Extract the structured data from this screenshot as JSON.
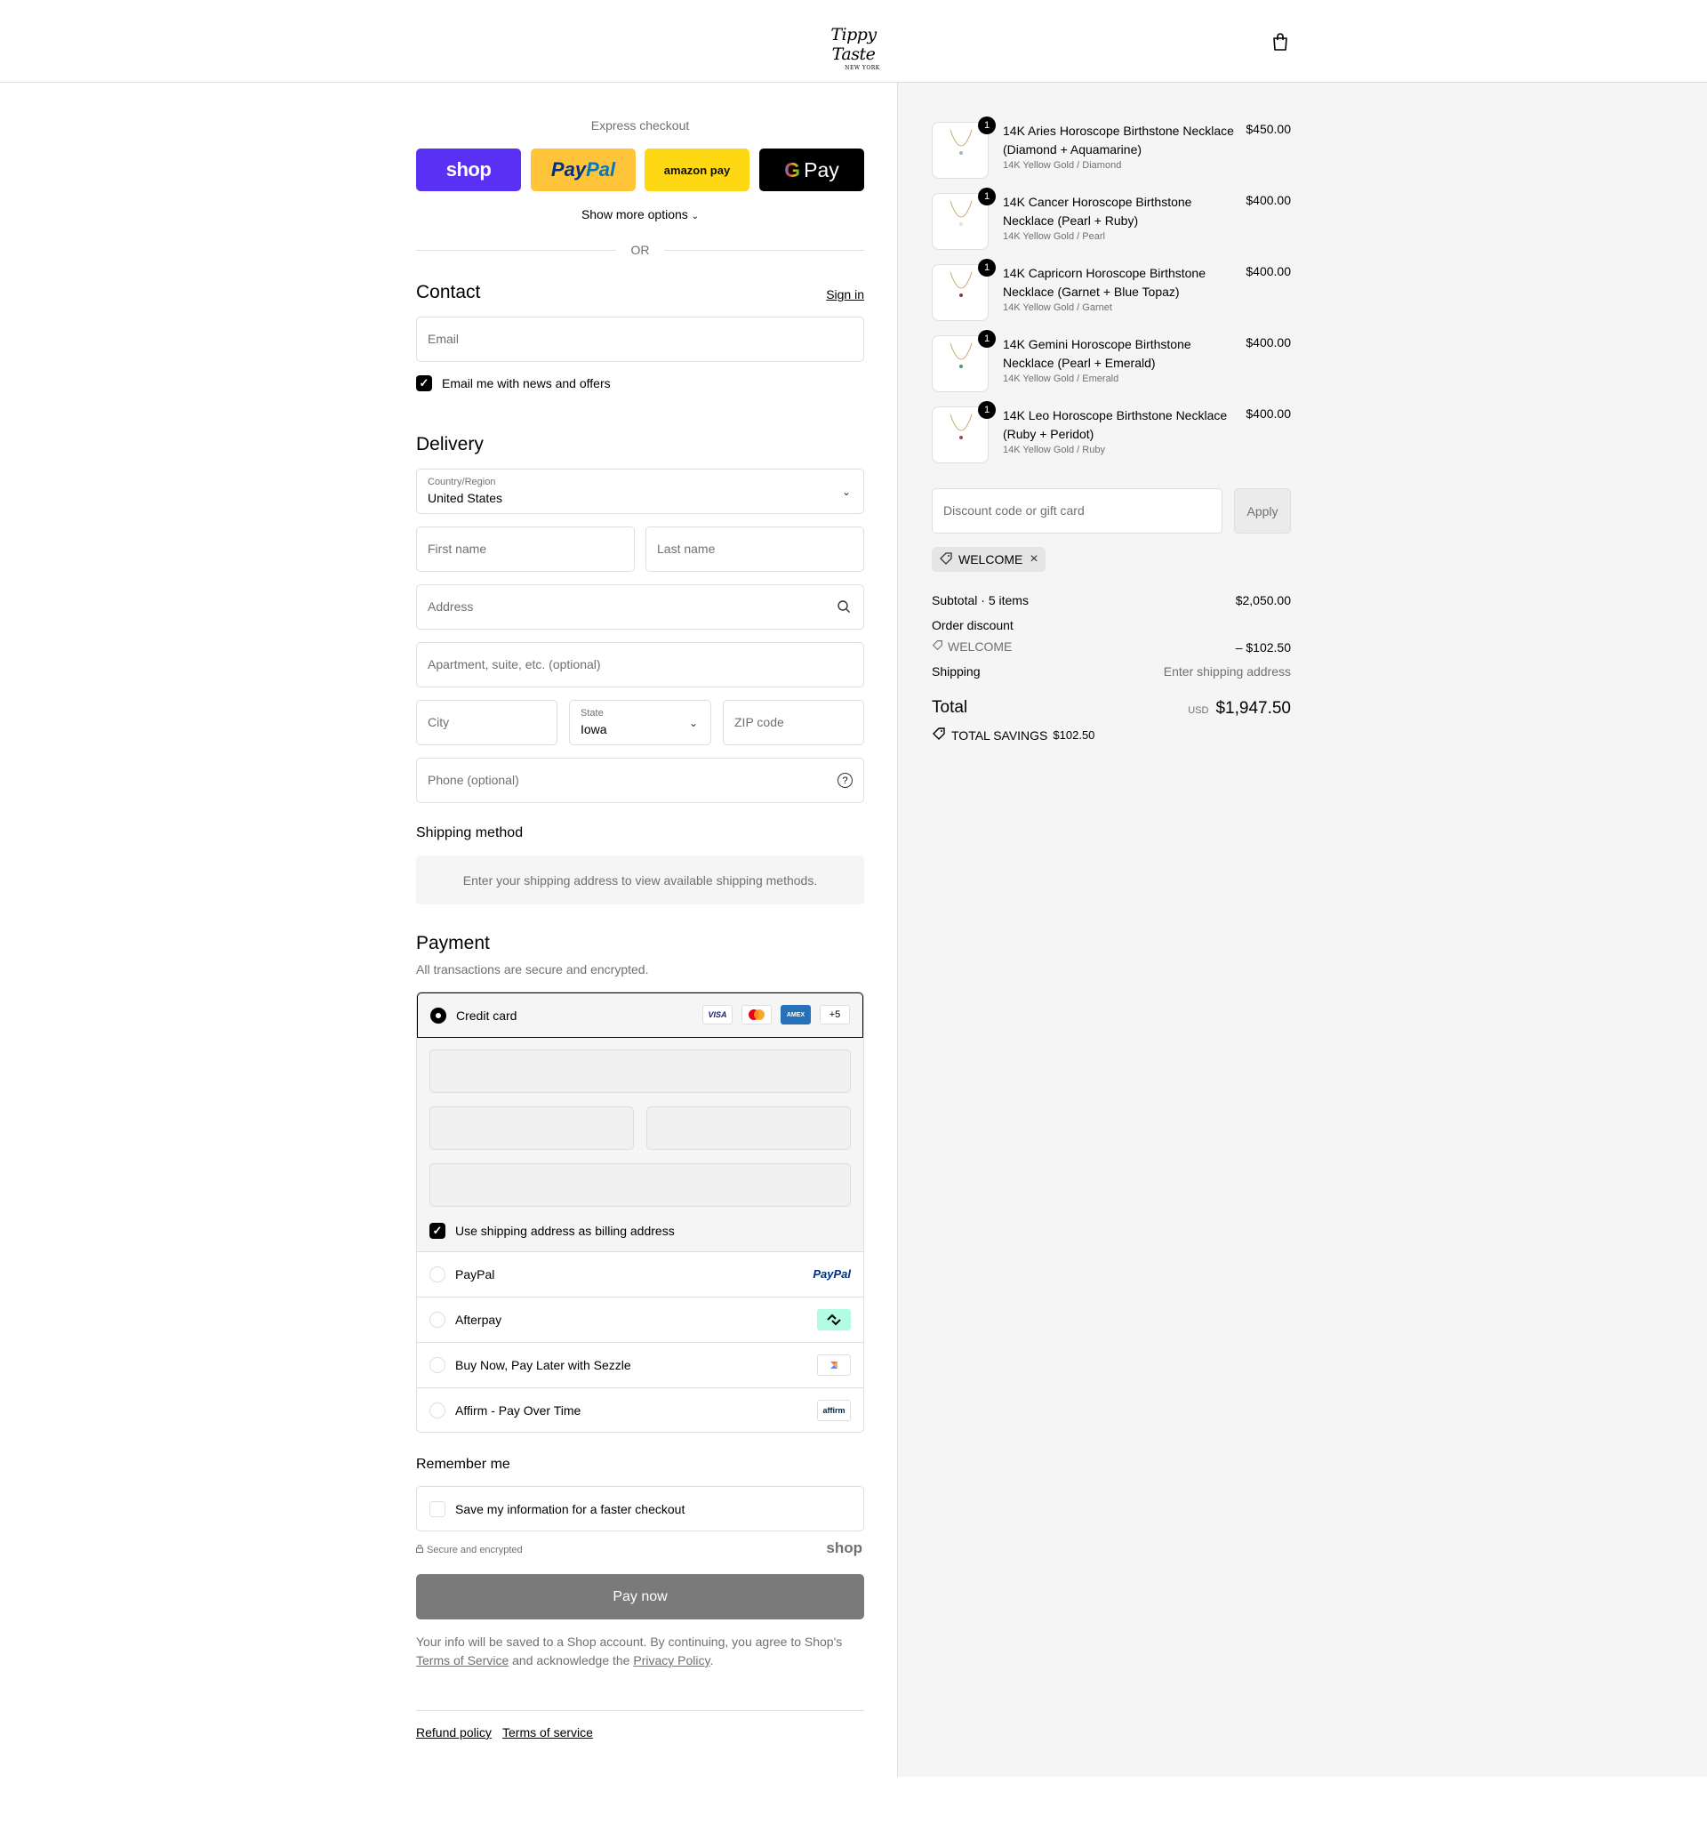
{
  "header": {
    "logo_main": "Tippy Taste",
    "logo_sub": "NEW YORK",
    "cart_icon": "shopping-bag-icon"
  },
  "express": {
    "title": "Express checkout",
    "shop_label": "shop",
    "paypal_pay": "Pay",
    "paypal_pal": "Pal",
    "amazon_label": "amazon pay",
    "gpay_g": "G",
    "gpay_label": "Pay",
    "show_more": "Show more options",
    "or": "OR"
  },
  "contact": {
    "heading": "Contact",
    "sign_in": "Sign in",
    "email_placeholder": "Email",
    "news_label": "Email me with news and offers",
    "news_checked": true
  },
  "delivery": {
    "heading": "Delivery",
    "country_label": "Country/Region",
    "country_value": "United States",
    "first_name": "First name",
    "last_name": "Last name",
    "address": "Address",
    "apartment": "Apartment, suite, etc. (optional)",
    "city": "City",
    "state_label": "State",
    "state_value": "Iowa",
    "zip": "ZIP code",
    "phone": "Phone (optional)"
  },
  "shipping_method": {
    "heading": "Shipping method",
    "message": "Enter your shipping address to view available shipping methods."
  },
  "payment": {
    "heading": "Payment",
    "subtitle": "All transactions are secure and encrypted.",
    "credit_card": "Credit card",
    "card_more": "+5",
    "billing_label": "Use shipping address as billing address",
    "options": [
      {
        "label": "PayPal",
        "logo": "PayPal"
      },
      {
        "label": "Afterpay",
        "logo": "afterpay-icon"
      },
      {
        "label": "Buy Now, Pay Later with Sezzle",
        "logo": "sezzle-icon"
      },
      {
        "label": "Affirm - Pay Over Time",
        "logo": "affirm"
      }
    ]
  },
  "remember": {
    "heading": "Remember me",
    "save_label": "Save my information for a faster checkout",
    "secure": "Secure and encrypted",
    "shop_mark": "shop"
  },
  "pay_now": "Pay now",
  "legal": {
    "line1": "Your info will be saved to a Shop account. By continuing, you agree to Shop's",
    "tos": "Terms of Service",
    "mid": "and acknowledge the",
    "privacy": "Privacy Policy",
    "end": "."
  },
  "footer": {
    "refund": "Refund policy",
    "terms": "Terms of service"
  },
  "order": {
    "items": [
      {
        "name": "14K Aries Horoscope Birthstone Necklace (Diamond + Aquamarine)",
        "variant": "14K Yellow Gold / Diamond",
        "price": "$450.00",
        "qty": "1"
      },
      {
        "name": "14K Cancer Horoscope Birthstone Necklace (Pearl + Ruby)",
        "variant": "14K Yellow Gold / Pearl",
        "price": "$400.00",
        "qty": "1"
      },
      {
        "name": "14K Capricorn Horoscope Birthstone Necklace (Garnet + Blue Topaz)",
        "variant": "14K Yellow Gold / Garnet",
        "price": "$400.00",
        "qty": "1"
      },
      {
        "name": "14K Gemini Horoscope Birthstone Necklace (Pearl + Emerald)",
        "variant": "14K Yellow Gold / Emerald",
        "price": "$400.00",
        "qty": "1"
      },
      {
        "name": "14K Leo Horoscope Birthstone Necklace (Ruby + Peridot)",
        "variant": "14K Yellow Gold / Ruby",
        "price": "$400.00",
        "qty": "1"
      }
    ],
    "discount_placeholder": "Discount code or gift card",
    "apply": "Apply",
    "code": "WELCOME",
    "subtotal_label": "Subtotal · 5 items",
    "subtotal_value": "$2,050.00",
    "order_discount": "Order discount",
    "discount_code": "WELCOME",
    "discount_value": "– $102.50",
    "shipping_label": "Shipping",
    "shipping_value": "Enter shipping address",
    "total_label": "Total",
    "currency": "USD",
    "total_value": "$1,947.50",
    "savings_label": "TOTAL SAVINGS",
    "savings_value": "$102.50"
  }
}
